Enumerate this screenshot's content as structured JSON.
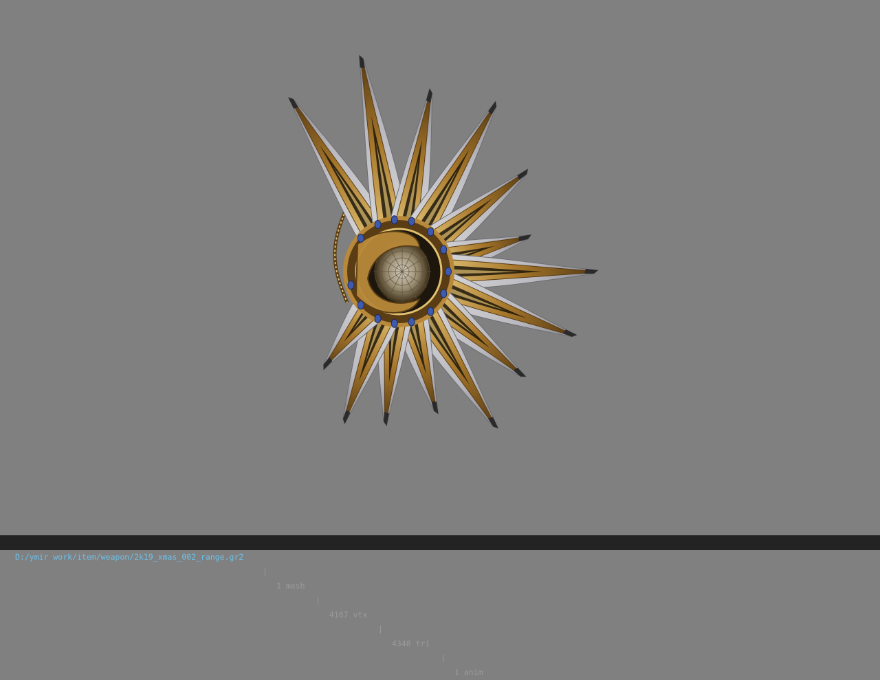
{
  "viewer": {
    "background_color": "#808080",
    "model_name": "2k19_xmas_002_range",
    "model_colors": {
      "blade_edge": "#c9c9cc",
      "blade_shadow": "#8e8e94",
      "gold": "#b8893a",
      "gold_dark": "#5a3d14",
      "gold_light": "#e0c070",
      "core_black": "#1c160c",
      "gem": "#3f5bb0"
    }
  },
  "status_bar": {
    "file_path": "D:/ymir work/item/weapon/2k19_xmas_002_range.gr2",
    "separator": "|",
    "mesh_count": "1 mesh",
    "vertex_count": "4167 vtx",
    "triangle_count": "4348 tri",
    "anim_count": "1 anim",
    "path_color": "#6cc0e8",
    "text_color": "#9a9a9a",
    "background_color": "#232323"
  }
}
